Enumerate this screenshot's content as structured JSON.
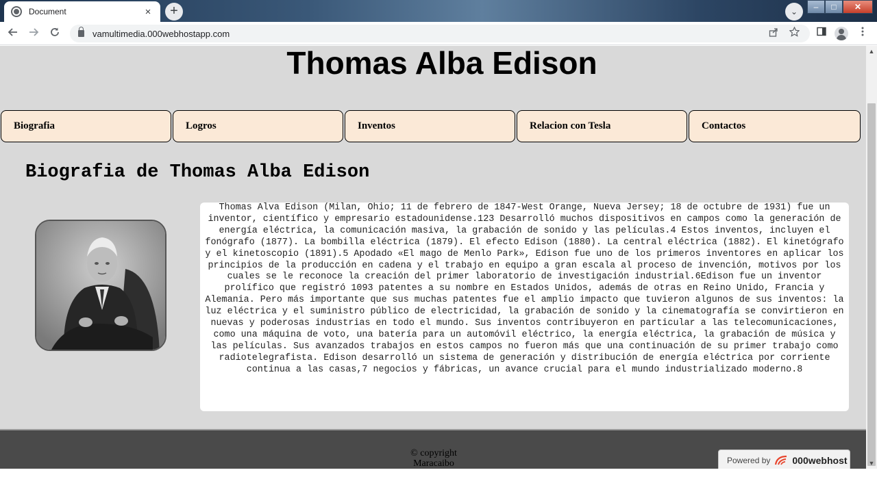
{
  "browser": {
    "tab_title": "Document",
    "tab_close": "×",
    "new_tab": "+",
    "url": "vamultimedia.000webhostapp.com",
    "profile_menu": "⌄",
    "window_controls": {
      "minimize": "–",
      "maximize": "□",
      "close": "✕"
    }
  },
  "page": {
    "title": "Thomas Alba Edison",
    "menu": [
      {
        "label": "Biografia"
      },
      {
        "label": "Logros"
      },
      {
        "label": "Inventos"
      },
      {
        "label": "Relacion con Tesla"
      },
      {
        "label": "Contactos"
      }
    ],
    "section_heading": "Biografia de Thomas Alba Edison",
    "portrait_icon": "portrait-photo-icon",
    "bio": "Thomas Alva Edison (Milan, Ohio; 11 de febrero de 1847-West Orange, Nueva Jersey; 18 de octubre de 1931) fue un inventor, científico y empresario estadounidense.123 Desarrolló muchos dispositivos en campos como la generación de energía eléctrica, la comunicación masiva, la grabación de sonido y las películas.4 Estos inventos, incluyen el fonógrafo (1877). La bombilla eléctrica (1879). El efecto Edison (1880). La central eléctrica (1882). El kinetógrafo y el kinetoscopio (1891).5 Apodado «El mago de Menlo Park», Edison fue uno de los primeros inventores en aplicar los principios de la producción en cadena y el trabajo en equipo a gran escala al proceso de invención, motivos por los cuales se le reconoce la creación del primer laboratorio de investigación industrial.6Edison fue un inventor prolífico que registró 1093 patentes a su nombre en Estados Unidos, además de otras en Reino Unido, Francia y Alemania. Pero más importante que sus muchas patentes fue el amplio impacto que tuvieron algunos de sus inventos: la luz eléctrica y el suministro público de electricidad, la grabación de sonido y la cinematografía se convirtieron en nuevas y poderosas industrias en todo el mundo. Sus inventos contribuyeron en particular a las telecomunicaciones, como una máquina de voto, una batería para un automóvil eléctrico, la energía eléctrica, la grabación de música y las películas. Sus avanzados trabajos en estos campos no fueron más que una continuación de su primer trabajo como radiotelegrafista. Edison desarrolló un sistema de generación y distribución de energía eléctrica por corriente continua a las casas,7 negocios y fábricas, un avance crucial para el mundo industrializado moderno.8",
    "footer_copyright": "© copyright",
    "footer_city": "Maracaibo",
    "powered_label": "Powered by",
    "powered_brand": "000webhost"
  }
}
